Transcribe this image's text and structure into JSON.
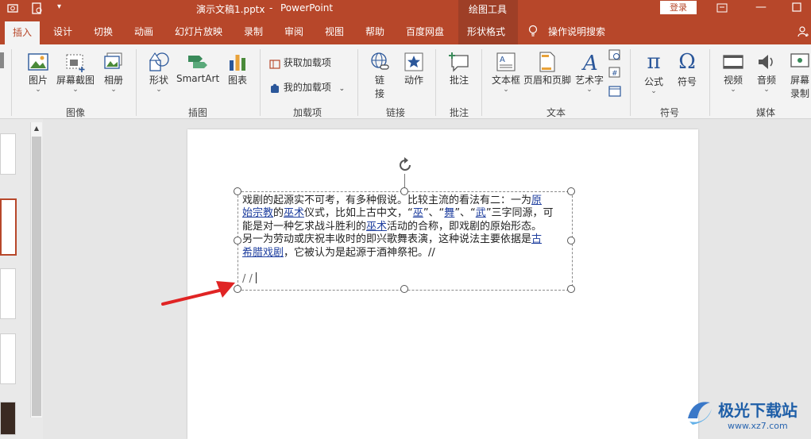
{
  "titlebar": {
    "filename": "演示文稿1.pptx",
    "separator": "-",
    "app": "PowerPoint",
    "drawing_tools": "绘图工具",
    "login": "登录",
    "accent": "#b7472a"
  },
  "tabs": {
    "insert": "插入",
    "design": "设计",
    "transitions": "切换",
    "animations": "动画",
    "slideshow": "幻灯片放映",
    "record": "录制",
    "review": "审阅",
    "view": "视图",
    "help": "帮助",
    "baidu": "百度网盘",
    "shape_format": "形状格式",
    "search": "操作说明搜索"
  },
  "ribbon": {
    "picture": "图片",
    "screenshot": "屏幕截图",
    "album": "相册",
    "images_group": "图像",
    "shapes": "形状",
    "smartart": "SmartArt",
    "chart": "图表",
    "illustrations_group": "插图",
    "get_addins": "获取加载项",
    "my_addins": "我的加载项",
    "addins_group": "加载项",
    "link_line1": "链",
    "link_line2": "接",
    "action": "动作",
    "links_group": "链接",
    "comment": "批注",
    "comments_group": "批注",
    "textbox": "文本框",
    "header_footer": "页眉和页脚",
    "wordart": "艺术字",
    "text_group": "文本",
    "equation": "公式",
    "symbol": "符号",
    "symbols_group": "符号",
    "video": "视频",
    "audio": "音频",
    "screen_record_line1": "屏幕",
    "screen_record_line2": "录制",
    "media_group": "媒体"
  },
  "slide": {
    "line1_a": "戏剧的起源实不可考，有多种假说。比较主流的看法有二：一为",
    "line1_link": "原",
    "line2_link1": "始宗教",
    "line2_a": "的",
    "line2_link2": "巫术",
    "line2_b": "仪式，比如上古中文，“",
    "line2_link3": "巫",
    "line2_c": "”、“",
    "line2_link4": "舞",
    "line2_d": "”、“",
    "line2_link5": "武",
    "line2_e": "”三字同源，可",
    "line3_a": "能是对一种乞求战斗胜利的",
    "line3_link": "巫术",
    "line3_b": "活动的合称，即戏剧的原始形态。",
    "line4_a": "另一为劳动或庆祝丰收时的即兴歌舞表演，这种说法主要依据是",
    "line4_link": "古",
    "line5_link": "希腊戏剧",
    "line5_a": "，它被认为是起源于酒神祭祀。//",
    "line7": "/ /"
  },
  "watermark": {
    "name": "极光下载站",
    "url": "www.xz7.com"
  }
}
